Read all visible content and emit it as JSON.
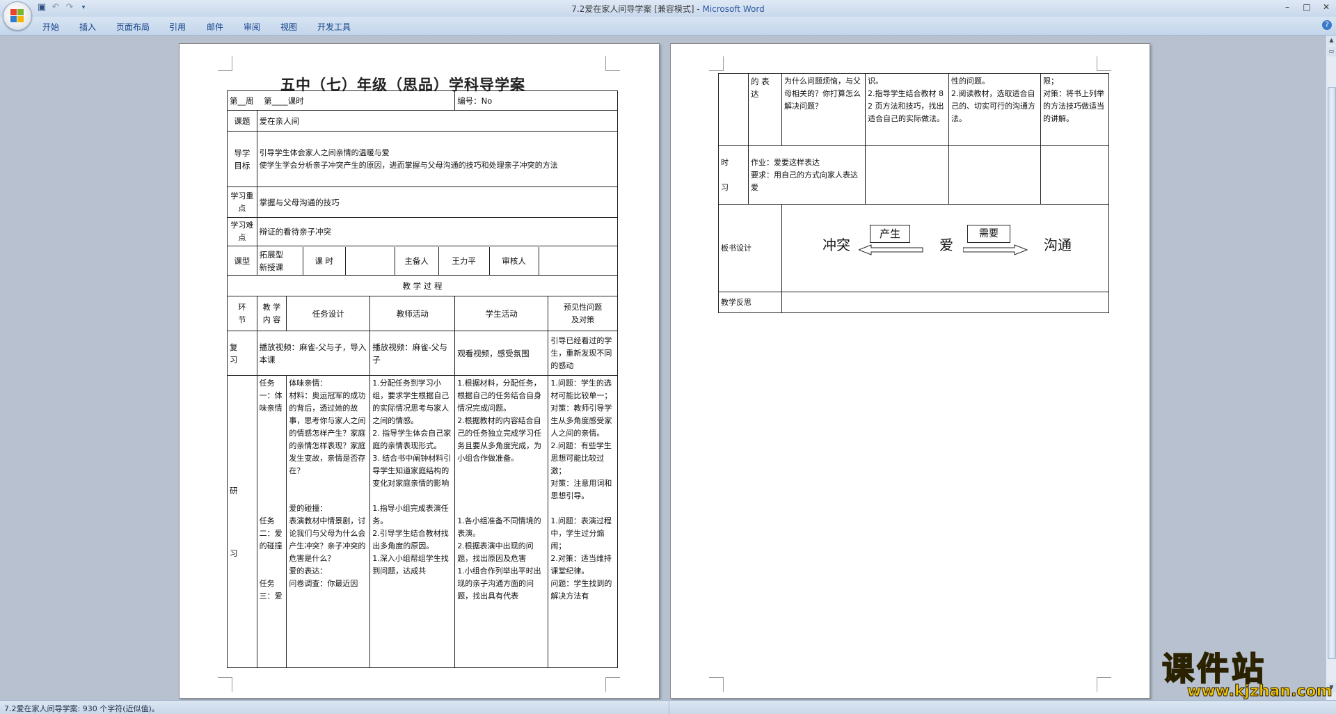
{
  "window": {
    "title": "7.2爱在家人间导学案 [兼容模式] - ",
    "app_name": "Microsoft Word",
    "controls": {
      "minimize": "–",
      "maximize": "□",
      "close": "✕"
    }
  },
  "qat": {
    "save_icon": "▣",
    "undo_icon": "↶",
    "redo_icon": "↷",
    "more_icon": "▾"
  },
  "ribbon": {
    "tabs": [
      "开始",
      "插入",
      "页面布局",
      "引用",
      "邮件",
      "审阅",
      "视图",
      "开发工具"
    ],
    "help": "?"
  },
  "status": {
    "text": "7.2爱在家人间导学案: 930 个字符(近似值)。"
  },
  "page1": {
    "title": "五中（七）年级（思品）学科导学案",
    "header": {
      "week": "第__周",
      "lesson": "第____课时",
      "number": "编号：No"
    },
    "topic_label": "课题",
    "topic": "爱在亲人间",
    "goal_label": "导学\n目标",
    "goal_text": "引导学生体会家人之间亲情的温暖与爱\n使学生学会分析亲子冲突产生的原因，进而掌握与父母沟通的技巧和处理亲子冲突的方法",
    "focus_label": "学习重点",
    "focus": "掌握与父母沟通的技巧",
    "difficulty_label": "学习难点",
    "difficulty": "辩证的看待亲子冲突",
    "type_label": "课型",
    "type": "拓展型\n新授课",
    "hours_label": "课  时",
    "preparer_label": "主备人",
    "preparer": "王力平",
    "reviewer_label": "审核人",
    "process_heading": "教      学      过      程",
    "col_headers": [
      "环\n节",
      "教 学\n内 容",
      "任务设计",
      "教师活动",
      "学生活动",
      "预见性问题\n及对策"
    ],
    "review_row": [
      "复\n习",
      "播放视频：麻雀-父与子，导入本课",
      "播放视频：麻雀-父与子",
      "观看视频，感受氛围",
      "引导已经看过的学生，重新发现不同的感动"
    ],
    "study_row": {
      "segment": "研\n\n\n\n\n习",
      "content": "任务一：体味亲情\n\n\n\n\n\n\n\n\n任务二：爱的碰撞\n\n\n任务三：爱",
      "task": "体味亲情：\n材料：奥运冠军的成功的背后，透过她的故事，思考你与家人之间的情感怎样产生？家庭的亲情怎样表现？家庭发生变故，亲情是否存在？\n\n\n爱的碰撞：\n表演教材中情景剧，讨论我们与父母为什么会产生冲突？亲子冲突的危害是什么？\n爱的表达：\n问卷调查：你最近因",
      "teacher": "1.分配任务到学习小组，要求学生根据自己的实际情况思考与家人之间的情感。\n2. 指导学生体会自己家庭的亲情表现形式。\n3. 结合书中阐钟材料引导学生知道家庭结构的变化对家庭亲情的影响\n\n1.指导小组完成表演任务。\n2.引导学生结合教材找出多角度的原因。\n1.深入小组帮组学生找到问题，达成共",
      "student": "1.根据材料，分配任务，根据自己的任务结合自身情况完成问题。\n2.根据教材的内容结合自己的任务独立完成学习任务且要从多角度完成，为小组合作做准备。\n\n\n\n\n1.各小组准备不同情境的表演。\n2.根据表演中出现的问题，找出原因及危害\n1.小组合作列举出平时出现的亲子沟通方面的问题，找出具有代表",
      "issues": "1.问题：学生的选材可能比较单一；\n对策：教师引导学生从多角度感受家人之间的亲情。\n2.问题：有些学生思想可能比较过激；\n对策：注意用词和思想引导。\n\n1.问题：表演过程中，学生过分煽闹；\n2.对策：适当维持课堂纪律。\n问题：学生找到的解决方法有"
    }
  },
  "page2": {
    "cont_row": [
      "",
      "的 表\n达",
      "为什么问题烦恼，与父母相关的？你打算怎么解决问题？",
      "识。\n2.指导学生结合教材 82 页方法和技巧，找出适合自己的实际做法。",
      "性的问题。\n2.阅读教材，选取适合自己的、切实可行的沟通方法。",
      "限；\n对策：将书上列举的方法技巧做适当的讲解。"
    ],
    "homework_label": "时\n\n习",
    "homework": "作业：爱要这样表达\n要求：用自己的方式向家人表达爱",
    "board_label": "板书设计",
    "board": {
      "left": "冲突",
      "produce": "产生",
      "love": "爱",
      "need": "需要",
      "right": "沟通"
    },
    "reflection_label": "教学反思"
  },
  "watermark": {
    "cn": "课件站",
    "url": "www.kjzhan.com"
  }
}
